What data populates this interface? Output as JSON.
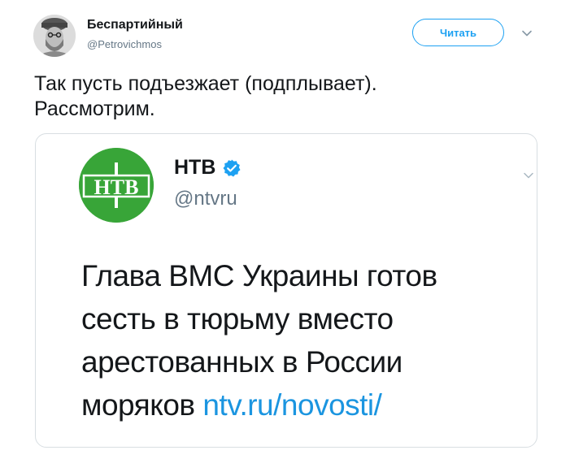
{
  "tweet": {
    "author": {
      "name": "Беспартийный",
      "handle": "@Petrovichmos"
    },
    "follow_label": "Читать",
    "text_lines": [
      "Так пусть подъезжает (подплывает).",
      "Рассмотрим."
    ]
  },
  "quoted": {
    "author": {
      "name": "НТВ",
      "handle": "@ntvru",
      "verified": true
    },
    "logo_text": "НТВ",
    "text_lines": [
      "Глава ВМС Украины готов",
      "сесть в тюрьму вместо",
      "арестованных в России",
      "моряков"
    ],
    "link_text": "ntv.ru/novosti/"
  },
  "colors": {
    "accent": "#1da1f2",
    "link": "#1b95e0",
    "ntv_green": "#38a538",
    "muted": "#657786"
  },
  "icons": {
    "menu_caret": "chevron-down-icon",
    "verified": "verified-badge-icon"
  }
}
